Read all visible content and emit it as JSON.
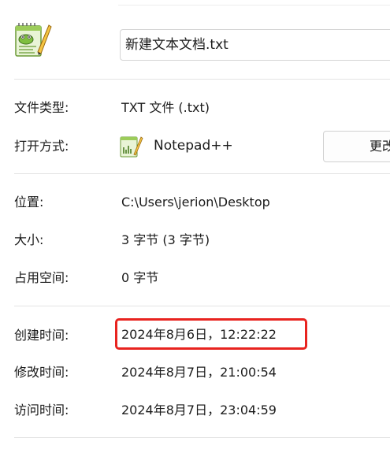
{
  "file": {
    "name": "新建文本文档.txt"
  },
  "fields": {
    "file_type": {
      "label": "文件类型:",
      "value": "TXT 文件 (.txt)"
    },
    "opens_with": {
      "label": "打开方式:",
      "app": "Notepad++",
      "button_label": "更改"
    },
    "location": {
      "label": "位置:",
      "value": "C:\\Users\\jerion\\Desktop"
    },
    "size": {
      "label": "大小:",
      "value": "3 字节 (3 字节)"
    },
    "size_on_disk": {
      "label": "占用空间:",
      "value": "0 字节"
    },
    "created": {
      "label": "创建时间:",
      "value": "2024年8月6日，12:22:22"
    },
    "modified": {
      "label": "修改时间:",
      "value": "2024年8月7日，21:00:54"
    },
    "accessed": {
      "label": "访问时间:",
      "value": "2024年8月7日，23:04:59"
    }
  },
  "icons": {
    "file_icon": "notepad-plus-plus-file-icon",
    "app_icon": "notepad-plus-plus-app-icon"
  },
  "colors": {
    "highlight": "#e8231f",
    "divider": "#e3e3e3",
    "icon_green": "#7fbf3f"
  }
}
